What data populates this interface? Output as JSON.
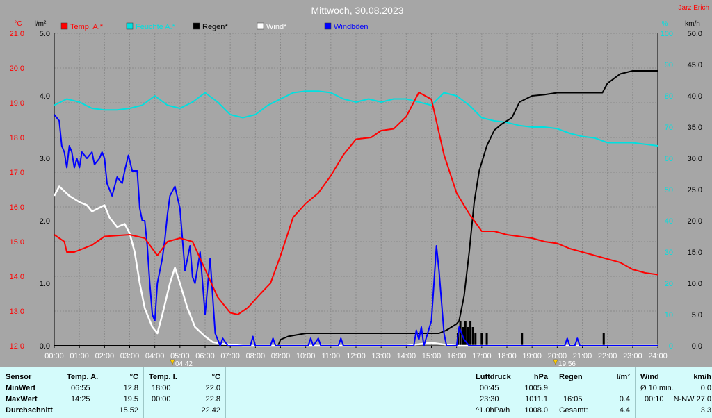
{
  "header": {
    "title": "Mittwoch, 30.08.2023",
    "station": "Jarz Erich",
    "unit_temp": "°C",
    "unit_rain": "l/m²",
    "unit_hum": "%",
    "unit_wind": "km/h"
  },
  "legend": [
    {
      "label": "Temp. A.*",
      "color": "#ff0000"
    },
    {
      "label": "Feuchte A.*",
      "color": "#00e0e0"
    },
    {
      "label": "Regen*",
      "color": "#000000"
    },
    {
      "label": "Wind*",
      "color": "#ffffff"
    },
    {
      "label": "Windböen",
      "color": "#0000ff"
    }
  ],
  "markers": {
    "sunrise": "04:42",
    "sunset": "19:56"
  },
  "chart_data": {
    "type": "line",
    "title": "Mittwoch, 30.08.2023",
    "x_ticks": [
      "00:00",
      "01:00",
      "02:00",
      "03:00",
      "04:00",
      "05:00",
      "06:00",
      "07:00",
      "08:00",
      "09:00",
      "10:00",
      "11:00",
      "12:00",
      "13:00",
      "14:00",
      "15:00",
      "16:00",
      "17:00",
      "18:00",
      "19:00",
      "20:00",
      "21:00",
      "22:00",
      "23:00",
      "24:00"
    ],
    "xlim": [
      0,
      24
    ],
    "axes": {
      "temp": {
        "label": "°C",
        "ylim": [
          12.0,
          21.0
        ],
        "ticks": [
          "12.0",
          "13.0",
          "14.0",
          "15.0",
          "16.0",
          "17.0",
          "18.0",
          "19.0",
          "20.0",
          "21.0"
        ]
      },
      "rain": {
        "label": "l/m²",
        "ylim": [
          0.0,
          5.0
        ],
        "ticks": [
          "0.0",
          "1.0",
          "2.0",
          "3.0",
          "4.0",
          "5.0"
        ]
      },
      "humidity": {
        "label": "%",
        "ylim": [
          0,
          100
        ],
        "ticks": [
          "0",
          "10",
          "20",
          "30",
          "40",
          "50",
          "60",
          "70",
          "80",
          "90",
          "100"
        ]
      },
      "wind": {
        "label": "km/h",
        "ylim": [
          0.0,
          50.0
        ],
        "ticks": [
          "0.0",
          "5.0",
          "10.0",
          "15.0",
          "20.0",
          "25.0",
          "30.0",
          "35.0",
          "40.0",
          "45.0",
          "50.0"
        ]
      }
    },
    "grid": true,
    "series": [
      {
        "name": "Temp. A.*",
        "axis": "temp",
        "color": "#ff0000",
        "points": [
          [
            0,
            15.2
          ],
          [
            0.4,
            15.0
          ],
          [
            0.5,
            14.7
          ],
          [
            0.8,
            14.7
          ],
          [
            1.5,
            14.9
          ],
          [
            2,
            15.15
          ],
          [
            3,
            15.2
          ],
          [
            3.6,
            15.1
          ],
          [
            4.1,
            14.6
          ],
          [
            4.5,
            15.0
          ],
          [
            5,
            15.1
          ],
          [
            5.5,
            15.0
          ],
          [
            6,
            14.2
          ],
          [
            6.5,
            13.4
          ],
          [
            7,
            12.95
          ],
          [
            7.3,
            12.9
          ],
          [
            7.7,
            13.1
          ],
          [
            8.2,
            13.5
          ],
          [
            8.6,
            13.8
          ],
          [
            9,
            14.6
          ],
          [
            9.5,
            15.7
          ],
          [
            10,
            16.1
          ],
          [
            10.5,
            16.4
          ],
          [
            11,
            16.9
          ],
          [
            11.5,
            17.5
          ],
          [
            12,
            17.95
          ],
          [
            12.6,
            18.0
          ],
          [
            13,
            18.2
          ],
          [
            13.5,
            18.25
          ],
          [
            14,
            18.6
          ],
          [
            14.5,
            19.3
          ],
          [
            15,
            19.1
          ],
          [
            15.5,
            17.5
          ],
          [
            16,
            16.4
          ],
          [
            16.5,
            15.8
          ],
          [
            17,
            15.3
          ],
          [
            17.5,
            15.3
          ],
          [
            18,
            15.2
          ],
          [
            18.5,
            15.15
          ],
          [
            19,
            15.1
          ],
          [
            19.5,
            15.0
          ],
          [
            20,
            14.95
          ],
          [
            20.5,
            14.8
          ],
          [
            21,
            14.7
          ],
          [
            21.5,
            14.6
          ],
          [
            22,
            14.5
          ],
          [
            22.5,
            14.4
          ],
          [
            23,
            14.2
          ],
          [
            23.5,
            14.1
          ],
          [
            24,
            14.05
          ]
        ]
      },
      {
        "name": "Feuchte A.*",
        "axis": "humidity",
        "color": "#00e0e0",
        "points": [
          [
            0,
            77
          ],
          [
            0.5,
            79
          ],
          [
            1,
            78
          ],
          [
            1.5,
            76
          ],
          [
            2,
            75.5
          ],
          [
            2.5,
            75.5
          ],
          [
            3,
            76
          ],
          [
            3.5,
            77
          ],
          [
            4,
            80
          ],
          [
            4.5,
            77
          ],
          [
            5,
            76
          ],
          [
            5.5,
            78
          ],
          [
            6,
            81
          ],
          [
            6.5,
            78
          ],
          [
            7,
            74
          ],
          [
            7.5,
            73
          ],
          [
            8,
            74
          ],
          [
            8.5,
            77
          ],
          [
            9,
            79
          ],
          [
            9.5,
            81
          ],
          [
            10,
            81.5
          ],
          [
            10.5,
            81.5
          ],
          [
            11,
            81
          ],
          [
            11.5,
            79
          ],
          [
            12,
            78
          ],
          [
            12.5,
            79
          ],
          [
            13,
            78
          ],
          [
            13.5,
            79
          ],
          [
            14,
            79
          ],
          [
            14.5,
            78
          ],
          [
            15,
            77
          ],
          [
            15.5,
            81
          ],
          [
            16,
            80
          ],
          [
            16.5,
            77
          ],
          [
            17,
            73
          ],
          [
            17.5,
            72
          ],
          [
            18,
            71.5
          ],
          [
            18.5,
            70.5
          ],
          [
            19,
            70
          ],
          [
            19.5,
            70
          ],
          [
            20,
            69.5
          ],
          [
            20.5,
            68
          ],
          [
            21,
            67
          ],
          [
            21.5,
            66.5
          ],
          [
            22,
            65
          ],
          [
            22.5,
            65
          ],
          [
            23,
            65
          ],
          [
            23.5,
            64.5
          ],
          [
            24,
            64
          ]
        ]
      },
      {
        "name": "Regen*",
        "axis": "rain",
        "color": "#000000",
        "points": [
          [
            0,
            0
          ],
          [
            8.9,
            0
          ],
          [
            9.0,
            0.1
          ],
          [
            9.3,
            0.15
          ],
          [
            10,
            0.2
          ],
          [
            11,
            0.2
          ],
          [
            14,
            0.2
          ],
          [
            15.3,
            0.2
          ],
          [
            15.6,
            0.25
          ],
          [
            16,
            0.35
          ],
          [
            16.1,
            0.4
          ],
          [
            16.3,
            0.8
          ],
          [
            16.5,
            1.5
          ],
          [
            16.7,
            2.3
          ],
          [
            16.9,
            2.8
          ],
          [
            17.2,
            3.2
          ],
          [
            17.5,
            3.45
          ],
          [
            17.8,
            3.55
          ],
          [
            18.2,
            3.65
          ],
          [
            18.5,
            3.9
          ],
          [
            19,
            4.0
          ],
          [
            19.5,
            4.02
          ],
          [
            20,
            4.05
          ],
          [
            21,
            4.05
          ],
          [
            21.8,
            4.05
          ],
          [
            22,
            4.2
          ],
          [
            22.5,
            4.35
          ],
          [
            23,
            4.4
          ],
          [
            24,
            4.4
          ]
        ]
      },
      {
        "name": "Wind*",
        "axis": "wind",
        "color": "#ffffff",
        "points": [
          [
            0,
            24
          ],
          [
            0.2,
            25.5
          ],
          [
            0.6,
            24
          ],
          [
            1,
            23
          ],
          [
            1.3,
            22.5
          ],
          [
            1.5,
            21.5
          ],
          [
            2,
            22.5
          ],
          [
            2.2,
            20.5
          ],
          [
            2.5,
            19
          ],
          [
            2.8,
            19.5
          ],
          [
            3.0,
            18
          ],
          [
            3.2,
            15
          ],
          [
            3.4,
            10
          ],
          [
            3.6,
            6
          ],
          [
            3.9,
            3
          ],
          [
            4.1,
            2
          ],
          [
            4.3,
            5
          ],
          [
            4.6,
            10
          ],
          [
            4.8,
            12.5
          ],
          [
            5,
            10
          ],
          [
            5.3,
            6
          ],
          [
            5.6,
            3
          ],
          [
            6,
            1.5
          ],
          [
            6.3,
            0.6
          ],
          [
            6.7,
            0.3
          ],
          [
            7,
            0.2
          ],
          [
            7.5,
            0
          ],
          [
            14,
            0
          ],
          [
            15,
            0.5
          ],
          [
            15.5,
            0.2
          ],
          [
            16,
            0
          ],
          [
            24,
            0
          ]
        ]
      },
      {
        "name": "Windböen",
        "axis": "wind",
        "color": "#0000ff",
        "points": [
          [
            0,
            37
          ],
          [
            0.2,
            36
          ],
          [
            0.3,
            32
          ],
          [
            0.4,
            31
          ],
          [
            0.5,
            28.5
          ],
          [
            0.6,
            32
          ],
          [
            0.7,
            31
          ],
          [
            0.8,
            28.5
          ],
          [
            0.9,
            30
          ],
          [
            1.0,
            28.5
          ],
          [
            1.1,
            31
          ],
          [
            1.3,
            30
          ],
          [
            1.5,
            31
          ],
          [
            1.6,
            29
          ],
          [
            1.8,
            30
          ],
          [
            1.9,
            31
          ],
          [
            2.0,
            30
          ],
          [
            2.1,
            26
          ],
          [
            2.3,
            24
          ],
          [
            2.5,
            27
          ],
          [
            2.7,
            26
          ],
          [
            2.8,
            28
          ],
          [
            2.95,
            30.5
          ],
          [
            3.1,
            28
          ],
          [
            3.3,
            28
          ],
          [
            3.4,
            22
          ],
          [
            3.5,
            20
          ],
          [
            3.6,
            20
          ],
          [
            3.7,
            16
          ],
          [
            3.8,
            10
          ],
          [
            3.9,
            5
          ],
          [
            4.0,
            4
          ],
          [
            4.1,
            10
          ],
          [
            4.3,
            14
          ],
          [
            4.4,
            17
          ],
          [
            4.5,
            21
          ],
          [
            4.6,
            24
          ],
          [
            4.8,
            25.5
          ],
          [
            5.0,
            22
          ],
          [
            5.2,
            12
          ],
          [
            5.4,
            16
          ],
          [
            5.5,
            11
          ],
          [
            5.6,
            10
          ],
          [
            5.8,
            15
          ],
          [
            6.0,
            5
          ],
          [
            6.2,
            14
          ],
          [
            6.4,
            2
          ],
          [
            6.6,
            0
          ],
          [
            6.7,
            1.2
          ],
          [
            6.9,
            0
          ],
          [
            7.8,
            0
          ],
          [
            7.9,
            1.5
          ],
          [
            8.0,
            0
          ],
          [
            8.6,
            0
          ],
          [
            8.7,
            1.2
          ],
          [
            8.8,
            0
          ],
          [
            10.1,
            0
          ],
          [
            10.2,
            1.2
          ],
          [
            10.3,
            0
          ],
          [
            10.5,
            1.2
          ],
          [
            10.6,
            0
          ],
          [
            11.3,
            0
          ],
          [
            11.4,
            1.2
          ],
          [
            11.5,
            0
          ],
          [
            14.3,
            0
          ],
          [
            14.4,
            2.5
          ],
          [
            14.5,
            1
          ],
          [
            14.6,
            3
          ],
          [
            14.7,
            0
          ],
          [
            15.0,
            4
          ],
          [
            15.2,
            16
          ],
          [
            15.3,
            12
          ],
          [
            15.5,
            2
          ],
          [
            15.6,
            0
          ],
          [
            16.0,
            0
          ],
          [
            16.1,
            3
          ],
          [
            16.3,
            1
          ],
          [
            16.5,
            0
          ],
          [
            20.3,
            0
          ],
          [
            20.4,
            1.2
          ],
          [
            20.5,
            0
          ],
          [
            20.7,
            0
          ],
          [
            20.8,
            1.2
          ],
          [
            20.9,
            0
          ],
          [
            24,
            0
          ]
        ]
      }
    ],
    "rain_bars_mm": [
      [
        16.05,
        0.2
      ],
      [
        16.15,
        0.4
      ],
      [
        16.25,
        0.3
      ],
      [
        16.35,
        0.4
      ],
      [
        16.45,
        0.3
      ],
      [
        16.55,
        0.4
      ],
      [
        16.65,
        0.3
      ],
      [
        16.75,
        0.2
      ],
      [
        17.0,
        0.2
      ],
      [
        17.2,
        0.2
      ],
      [
        18.6,
        0.2
      ],
      [
        21.85,
        0.2
      ]
    ]
  },
  "stats": {
    "sensor": {
      "header": "Sensor",
      "rows": [
        "MinWert",
        "MaxWert",
        "Durchschnitt"
      ]
    },
    "temp_a": {
      "header": "Temp. A.",
      "unit": "°C",
      "min_time": "06:55",
      "min_val": "12.8",
      "max_time": "14:25",
      "max_val": "19.5",
      "avg": "15.52"
    },
    "temp_i": {
      "header": "Temp. I.",
      "unit": "°C",
      "min_time": "18:00",
      "min_val": "22.0",
      "max_time": "00:00",
      "max_val": "22.8",
      "avg": "22.42"
    },
    "pressure": {
      "header": "Luftdruck",
      "unit": "hPa",
      "min_time": "00:45",
      "min_val": "1005.9",
      "max_time": "23:30",
      "max_val": "1011.1",
      "trend_label": "^1.0hPa/h",
      "trend_val": "1008.0"
    },
    "rain": {
      "header": "Regen",
      "unit": "l/m²",
      "max_time": "16:05",
      "max_val": "0.4",
      "total_label": "Gesamt:",
      "total_val": "4.4"
    },
    "wind": {
      "header": "Wind",
      "unit": "km/h",
      "avg_label": "Ø 10 min.",
      "avg_val": "0.0",
      "max_time": "00:10",
      "max_val": "N-NW 27.0",
      "day_avg": "3.3"
    }
  }
}
